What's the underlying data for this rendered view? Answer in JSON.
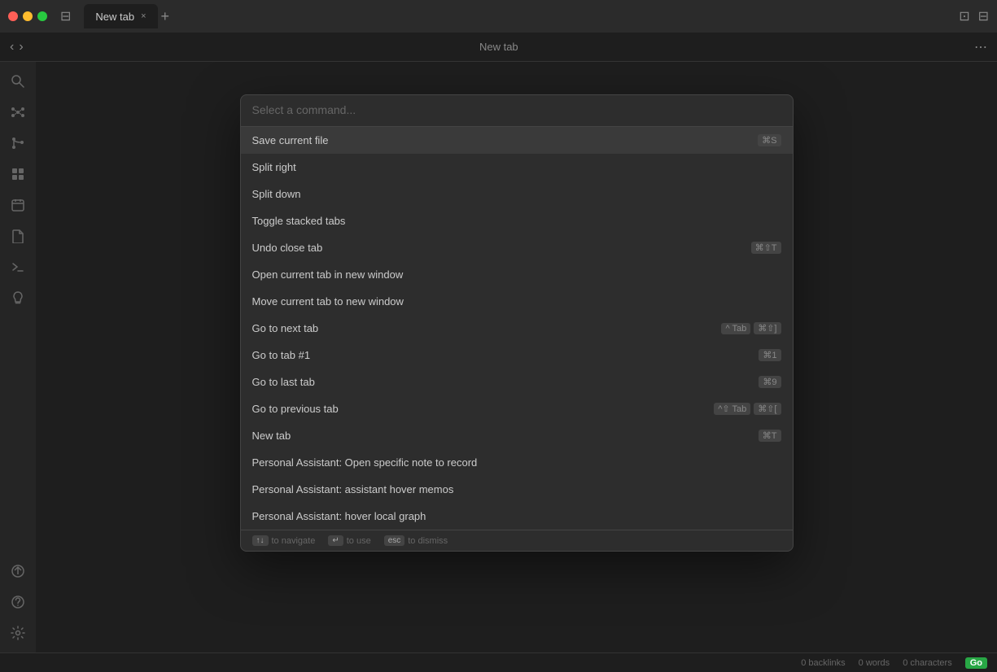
{
  "titlebar": {
    "tab_label": "New tab",
    "add_tab_icon": "+",
    "close_icon": "×"
  },
  "toolbar": {
    "title": "New tab",
    "back_icon": "‹",
    "forward_icon": "›",
    "more_icon": "⋯"
  },
  "sidebar": {
    "icons": [
      {
        "name": "search-icon",
        "symbol": "⊙"
      },
      {
        "name": "graph-icon",
        "symbol": "⌘"
      },
      {
        "name": "branches-icon",
        "symbol": "⑂"
      },
      {
        "name": "grid-icon",
        "symbol": "⊞"
      },
      {
        "name": "calendar-icon",
        "symbol": "▦"
      },
      {
        "name": "file-icon",
        "symbol": "□"
      },
      {
        "name": "terminal-icon",
        "symbol": ">"
      },
      {
        "name": "lightbulb-icon",
        "symbol": "✦"
      }
    ],
    "bottom_icons": [
      {
        "name": "publish-icon",
        "symbol": "↑"
      },
      {
        "name": "help-icon",
        "symbol": "?"
      },
      {
        "name": "settings-icon",
        "symbol": "⚙"
      }
    ]
  },
  "command_palette": {
    "placeholder": "Select a command...",
    "commands": [
      {
        "label": "Save current file",
        "shortcut": [
          "⌘",
          "S"
        ],
        "selected": true
      },
      {
        "label": "Split right",
        "shortcut": []
      },
      {
        "label": "Split down",
        "shortcut": []
      },
      {
        "label": "Toggle stacked tabs",
        "shortcut": []
      },
      {
        "label": "Undo close tab",
        "shortcut": [
          "⌘",
          "⇧",
          "T"
        ]
      },
      {
        "label": "Open current tab in new window",
        "shortcut": []
      },
      {
        "label": "Move current tab to new window",
        "shortcut": []
      },
      {
        "label": "Go to next tab",
        "shortcut_multi": [
          "^ Tab",
          "⌘⇧]"
        ]
      },
      {
        "label": "Go to tab #1",
        "shortcut": [
          "⌘",
          "1"
        ]
      },
      {
        "label": "Go to last tab",
        "shortcut": [
          "⌘",
          "9"
        ]
      },
      {
        "label": "Go to previous tab",
        "shortcut_multi": [
          "^⇧ Tab",
          "⌘⇧["
        ]
      },
      {
        "label": "New tab",
        "shortcut": [
          "⌘",
          "T"
        ]
      },
      {
        "label": "Personal Assistant: Open specific note to record",
        "shortcut": []
      },
      {
        "label": "Personal Assistant: assistant hover memos",
        "shortcut": []
      },
      {
        "label": "Personal Assistant: hover local graph",
        "shortcut": []
      }
    ],
    "footer": {
      "navigate": "to navigate",
      "use": "to use",
      "dismiss": "to dismiss",
      "navigate_keys": [
        "↑↓"
      ],
      "use_key": "↵",
      "dismiss_key": "esc"
    }
  },
  "statusbar": {
    "backlinks": "0 backlinks",
    "words": "0 words",
    "characters": "0 characters",
    "go_label": "Go"
  }
}
